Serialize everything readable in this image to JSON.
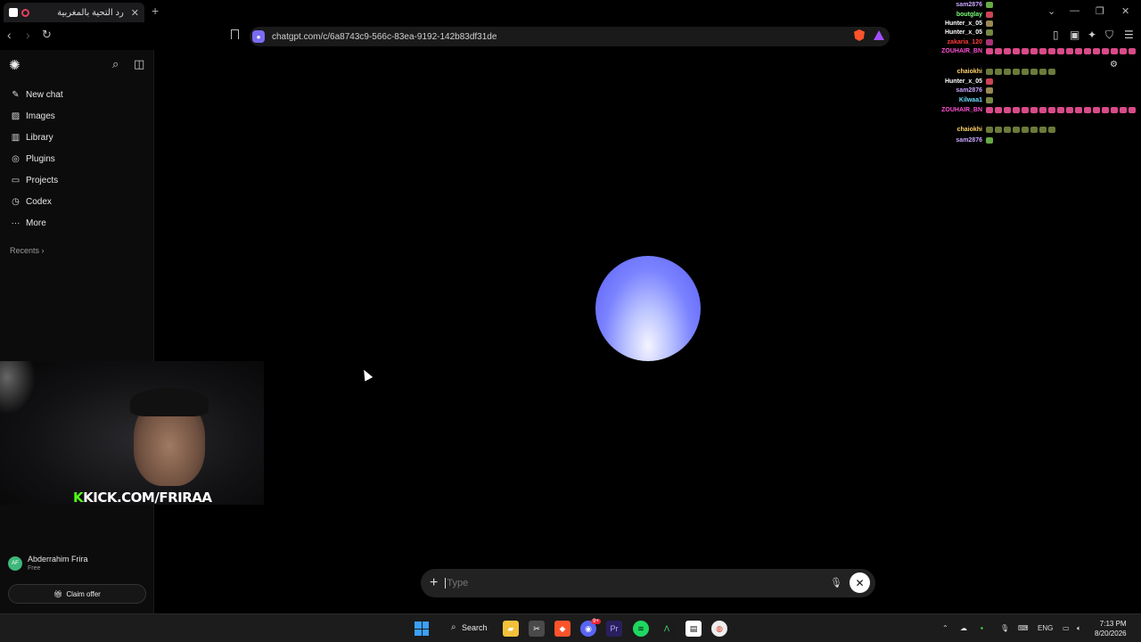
{
  "browser": {
    "tab_title": "رد التحية بالمغربية",
    "tab_close": "✕",
    "new_tab": "+",
    "url": "chatgpt.com/c/6a8743c9-566c-83ea-9192-142b83df31de"
  },
  "sidebar": {
    "items": [
      {
        "label": "New chat",
        "icon": "✎"
      },
      {
        "label": "Images",
        "icon": "▨"
      },
      {
        "label": "Library",
        "icon": "▥"
      },
      {
        "label": "Plugins",
        "icon": "◎"
      },
      {
        "label": "Projects",
        "icon": "▭"
      },
      {
        "label": "Codex",
        "icon": "◷"
      },
      {
        "label": "More",
        "icon": "···"
      }
    ],
    "recents_label": "Recents ›",
    "user_name": "Abderrahim Frira",
    "user_initials": "AF",
    "user_plan": "Free",
    "claim_label": "Claim offer"
  },
  "stream": {
    "overlay_text": "KICK.COM/FRIRAA",
    "overlay_k": "K"
  },
  "composer": {
    "placeholder": "Type",
    "plus": "+",
    "close": "✕"
  },
  "chat": [
    {
      "name": "sam2876",
      "color": "#c9a7ff"
    },
    {
      "name": "boutglay",
      "color": "#7dff7a"
    },
    {
      "name": "Hunter_x_05",
      "color": "#ffffff"
    },
    {
      "name": "Hunter_x_05",
      "color": "#ffffff"
    },
    {
      "name": "zakaria_120",
      "color": "#ff3b3b"
    },
    {
      "name": "ZOUHAIR_BN",
      "color": "#ff4fd2"
    },
    {
      "name": "chaiokhi",
      "color": "#ffd36b"
    },
    {
      "name": "Hunter_x_05",
      "color": "#ffffff"
    },
    {
      "name": "sam2876",
      "color": "#c9a7ff"
    },
    {
      "name": "Kilwaa1",
      "color": "#6bdcff"
    },
    {
      "name": "ZOUHAIR_BN",
      "color": "#ff4fd2"
    },
    {
      "name": "chaiokhi",
      "color": "#ffd36b"
    },
    {
      "name": "sam2876",
      "color": "#c9a7ff"
    }
  ],
  "taskbar": {
    "search_label": "Search",
    "lang": "ENG",
    "time": "7:13 PM",
    "date": "8/20/2026",
    "discord_badge": "9+"
  },
  "colors": {
    "orb_top": "#5a5ef5",
    "orb_bottom": "#f4f4ff",
    "kick_green": "#53fc18"
  }
}
